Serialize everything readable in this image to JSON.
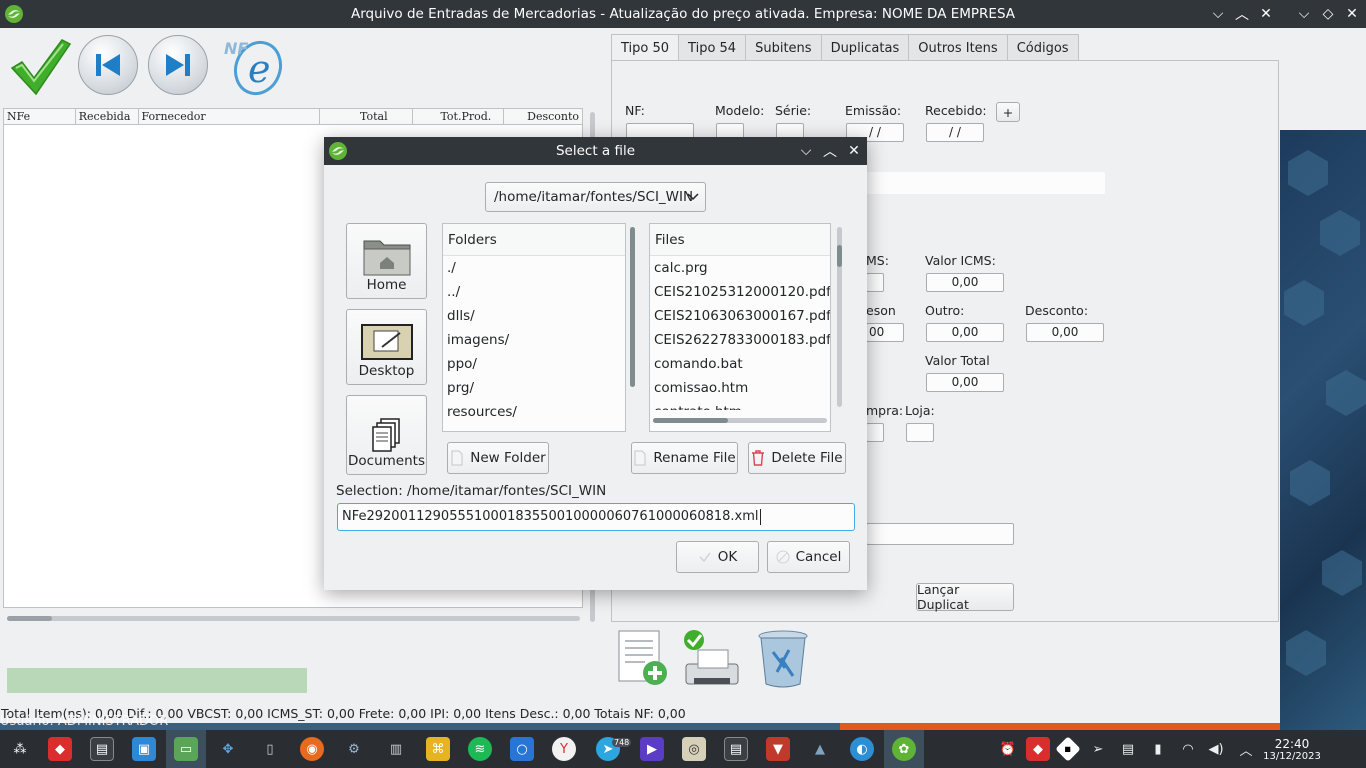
{
  "window": {
    "title": "Arquivo de Entradas de Mercadorias - Atualização do preço ativada. Empresa: NOME DA EMPRESA"
  },
  "toolbar": {
    "confirm_icon": "check-icon",
    "prev_icon": "skip-back-icon",
    "next_icon": "skip-forward-icon",
    "nfe_logo": "NFe"
  },
  "grid": {
    "columns": [
      "NFe",
      "Recebida",
      "Fornecedor",
      "Total",
      "Tot.Prod.",
      "Desconto"
    ]
  },
  "tabs": [
    "Tipo 50",
    "Tipo 54",
    "Subitens",
    "Duplicatas",
    "Outros Itens",
    "Códigos"
  ],
  "form": {
    "nf_label": "NF:",
    "modelo_label": "Modelo:",
    "serie_label": "Série:",
    "emissao_label": "Emissão:",
    "emissao_value": " / /",
    "recebido_label": "Recebido:",
    "recebido_value": " / /",
    "plus_label": "+",
    "icms_label_partial": "MS:",
    "valor_icms_label": "Valor ICMS:",
    "valor_icms_value": "0,00",
    "pason_label_partial": "eson",
    "pason_value_partial": "00",
    "outro_label": "Outro:",
    "outro_value": "0,00",
    "desconto_label": "Desconto:",
    "desconto_value": "0,00",
    "valor_total_label": "Valor Total",
    "valor_total_value": "0,00",
    "compra_label_partial": "mpra:",
    "loja_label": "Loja:",
    "lancar_button": "Lançar Duplicat"
  },
  "statusbar": {
    "text": "Total Item(ns):        0,00 Dif.:           0,00 VBCST:        0,00 ICMS_ST:          0,00 Frete:        0,00 IPI:       0,00 Itens Desc.:         0,00 Totais NF:         0,00",
    "ghost_text": "Usuário: ADMINISTRADOR"
  },
  "dialog": {
    "title": "Select a file",
    "path": "/home/itamar/fontes/SCI_WIN",
    "places": [
      "Home",
      "Desktop",
      "Documents"
    ],
    "folders_header": "Folders",
    "folders": [
      "./",
      "../",
      "dlls/",
      "imagens/",
      "ppo/",
      "prg/",
      "resources/"
    ],
    "files_header": "Files",
    "files": [
      "calc.prg",
      "CEIS21025312000120.pdf",
      "CEIS21063063000167.pdf",
      "CEIS26227833000183.pdf",
      "comando.bat",
      "comissao.htm",
      "contrato.htm"
    ],
    "new_folder": "New Folder",
    "rename_file": "Rename File",
    "delete_file": "Delete File",
    "selection_label": "Selection: /home/itamar/fontes/SCI_WIN",
    "selection_value": "NFe29200112905551000183550010000060761000060818.xml",
    "ok": "OK",
    "cancel": "Cancel"
  },
  "taskbar": {
    "time": "22:40",
    "date": "13/12/2023",
    "badge": "748"
  }
}
